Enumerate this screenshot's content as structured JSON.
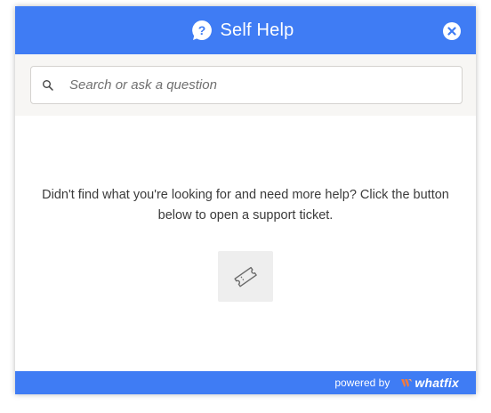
{
  "header": {
    "title": "Self Help",
    "help_icon": "help-bubble-icon",
    "close_icon": "close-icon"
  },
  "search": {
    "placeholder": "Search or ask a question",
    "icon": "search-icon"
  },
  "main": {
    "message": "Didn't find what you're looking for and need more help? Click the button below to open a support ticket.",
    "ticket_icon": "ticket-icon"
  },
  "footer": {
    "powered_by": "powered by",
    "brand": "whatfix"
  },
  "colors": {
    "header_bg": "#3f7cf4",
    "footer_bg": "#3f7cf4",
    "brand_accent": "#f47a3c",
    "text": "#3b3b3b"
  }
}
